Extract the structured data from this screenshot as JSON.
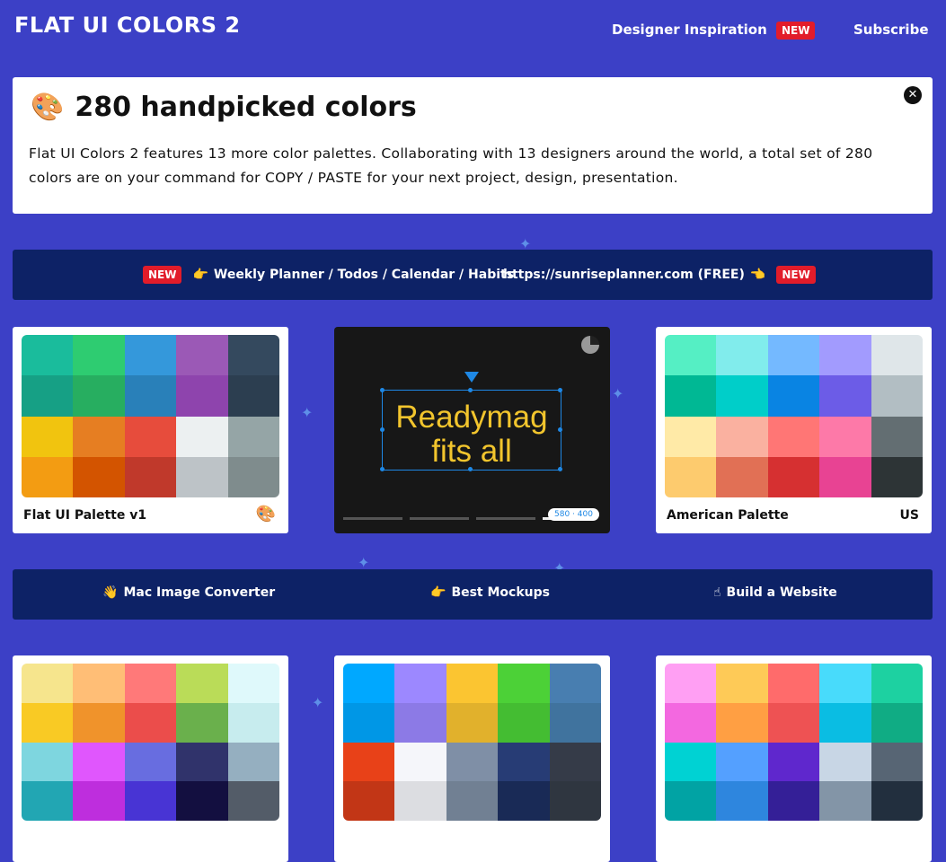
{
  "header": {
    "logo": "FLAT UI COLORS 2",
    "nav_inspiration": "Designer Inspiration",
    "nav_badge": "NEW",
    "nav_subscribe": "Subscribe"
  },
  "intro": {
    "emoji": "🎨",
    "title": "280 handpicked colors",
    "body": "Flat UI Colors 2 features 13 more color palettes. Collaborating with 13 designers around the world, a total set of 280 colors are on your command for COPY / PASTE for your next project, design, presentation.",
    "close_icon": "close-icon",
    "close_glyph": "✕"
  },
  "promo_top": {
    "badge_left": "NEW",
    "planner_emoji": "👉",
    "planner_label": "Weekly Planner / Todos / Calendar / Habits",
    "url_label": "https://sunriseplanner.com (FREE)",
    "url_emoji": "👈",
    "badge_right": "NEW"
  },
  "promo_bottom": {
    "items": [
      {
        "emoji": "👋",
        "label": "Mac Image Converter"
      },
      {
        "emoji": "👉",
        "label": "Best Mockups"
      },
      {
        "emoji": "☝",
        "label": "Build a Website"
      }
    ]
  },
  "ad": {
    "line1": "Readymag",
    "line2": "fits all",
    "size_label": "580 · 400"
  },
  "palettes": [
    {
      "name": "Flat UI Palette v1",
      "flag": "🎨",
      "colors": [
        "#1abc9c",
        "#2ecc71",
        "#3498db",
        "#9b59b6",
        "#34495e",
        "#16a085",
        "#27ae60",
        "#2980b9",
        "#8e44ad",
        "#2c3e50",
        "#f1c40f",
        "#e67e22",
        "#e74c3c",
        "#ecf0f1",
        "#95a5a6",
        "#f39c12",
        "#d35400",
        "#c0392b",
        "#bdc3c7",
        "#7f8c8d"
      ]
    },
    {
      "name": "American Palette",
      "flag": "US",
      "colors": [
        "#55efc4",
        "#81ecec",
        "#74b9ff",
        "#a29bfe",
        "#dfe6e9",
        "#00b894",
        "#00cec9",
        "#0984e3",
        "#6c5ce7",
        "#b2bec3",
        "#ffeaa7",
        "#fab1a0",
        "#ff7675",
        "#fd79a8",
        "#636e72",
        "#fdcb6e",
        "#e17055",
        "#d63031",
        "#e84393",
        "#2d3436"
      ]
    },
    {
      "name": "",
      "flag": "",
      "colors": [
        "#f6e58d",
        "#ffbe76",
        "#ff7979",
        "#badc58",
        "#dff9fb",
        "#f9ca24",
        "#f0932b",
        "#eb4d4b",
        "#6ab04c",
        "#c7ecee",
        "#7ed6df",
        "#e056fd",
        "#686de0",
        "#30336b",
        "#95afc0",
        "#22a6b3",
        "#be2edd",
        "#4834d4",
        "#130f40",
        "#535c68"
      ]
    },
    {
      "name": "",
      "flag": "",
      "colors": [
        "#00a8ff",
        "#9c88ff",
        "#fbc531",
        "#4cd137",
        "#487eb0",
        "#0097e6",
        "#8c7ae6",
        "#e1b12c",
        "#44bd32",
        "#40739e",
        "#e84118",
        "#f5f6fa",
        "#7f8fa6",
        "#273c75",
        "#353b48",
        "#c23616",
        "#dcdde1",
        "#718093",
        "#192a56",
        "#2f3640"
      ]
    },
    {
      "name": "",
      "flag": "",
      "colors": [
        "#ff9ff3",
        "#feca57",
        "#ff6b6b",
        "#48dbfb",
        "#1dd1a1",
        "#f368e0",
        "#ff9f43",
        "#ee5253",
        "#0abde3",
        "#10ac84",
        "#00d2d3",
        "#54a0ff",
        "#5f27cd",
        "#c8d6e5",
        "#576574",
        "#01a3a4",
        "#2e86de",
        "#341f97",
        "#8395a7",
        "#222f3e"
      ]
    }
  ]
}
